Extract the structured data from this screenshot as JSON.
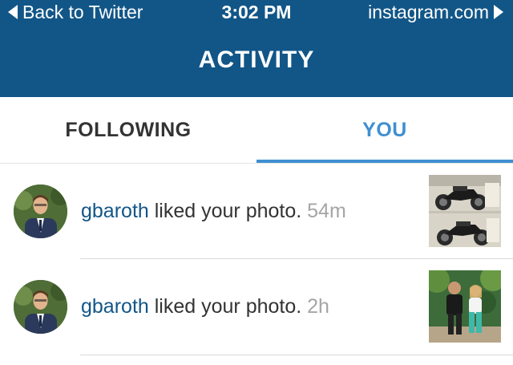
{
  "status_bar": {
    "back_label": "Back to Twitter",
    "time": "3:02 PM",
    "site": "instagram.com"
  },
  "header": {
    "title": "ACTIVITY"
  },
  "tabs": [
    {
      "label": "FOLLOWING",
      "active": false
    },
    {
      "label": "YOU",
      "active": true
    }
  ],
  "activity": [
    {
      "username": "gbaroth",
      "action": "liked your photo.",
      "time": "54m",
      "thumbnail": "motorcycles-photo"
    },
    {
      "username": "gbaroth",
      "action": "liked your photo.",
      "time": "2h",
      "thumbnail": "two-people-photo"
    }
  ],
  "colors": {
    "header_bg": "#125688",
    "active_tab": "#3f8fd2",
    "username": "#125688",
    "timestamp": "#a5a5a5"
  }
}
